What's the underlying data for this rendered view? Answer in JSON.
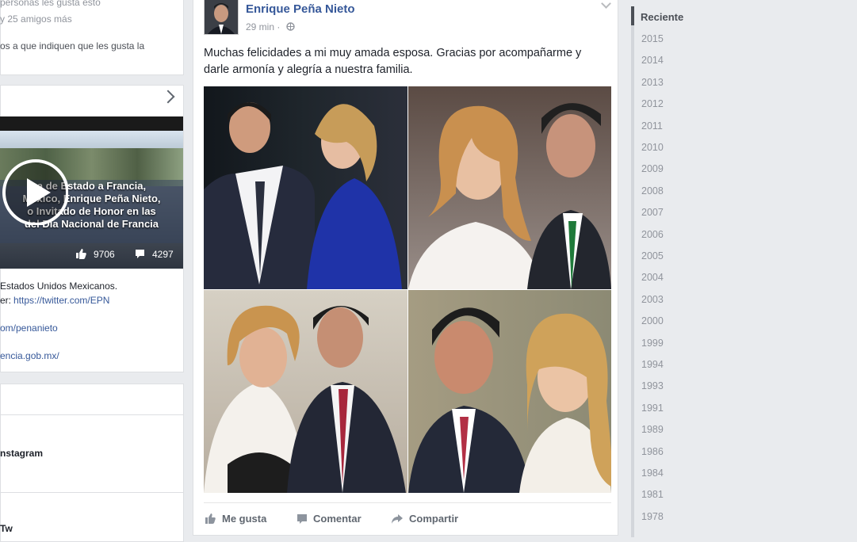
{
  "left": {
    "likes_line1": "personas les gusta esto",
    "likes_line2": "y 25 amigos más",
    "invite_text": "os a que indiquen que les gusta la",
    "video": {
      "line1": "a de Estado a Francia,",
      "line2": "México, Enrique Peña Nieto,",
      "line3": "o Invitado de Honor en las",
      "line4": "del Día Nacional de Francia",
      "likes": "9706",
      "comments": "4297"
    },
    "about": {
      "desc": "Estados Unidos Mexicanos.",
      "twitter_prefix": "er:",
      "twitter_link": "https://twitter.com/EPN",
      "fb_link": "om/penanieto",
      "web_link": "encia.gob.mx/"
    },
    "instagram_label": "nstagram",
    "bottom_label": "Tw"
  },
  "post": {
    "author": "Enrique Peña Nieto",
    "time": "29 min ·",
    "text": "Muchas felicidades a mi muy amada esposa. Gracias por acompañarme y darle armonía y alegría a nuestra familia.",
    "like_label": "Me gusta",
    "comment_label": "Comentar",
    "share_label": "Compartir"
  },
  "timeline": {
    "active": "Reciente",
    "years": [
      "2015",
      "2014",
      "2013",
      "2012",
      "2011",
      "2010",
      "2009",
      "2008",
      "2007",
      "2006",
      "2005",
      "2004",
      "2003",
      "2000",
      "1999",
      "1994",
      "1993",
      "1991",
      "1989",
      "1986",
      "1984",
      "1981",
      "1978"
    ]
  },
  "colors": {
    "link": "#365899",
    "accent": "#4b4f56"
  }
}
